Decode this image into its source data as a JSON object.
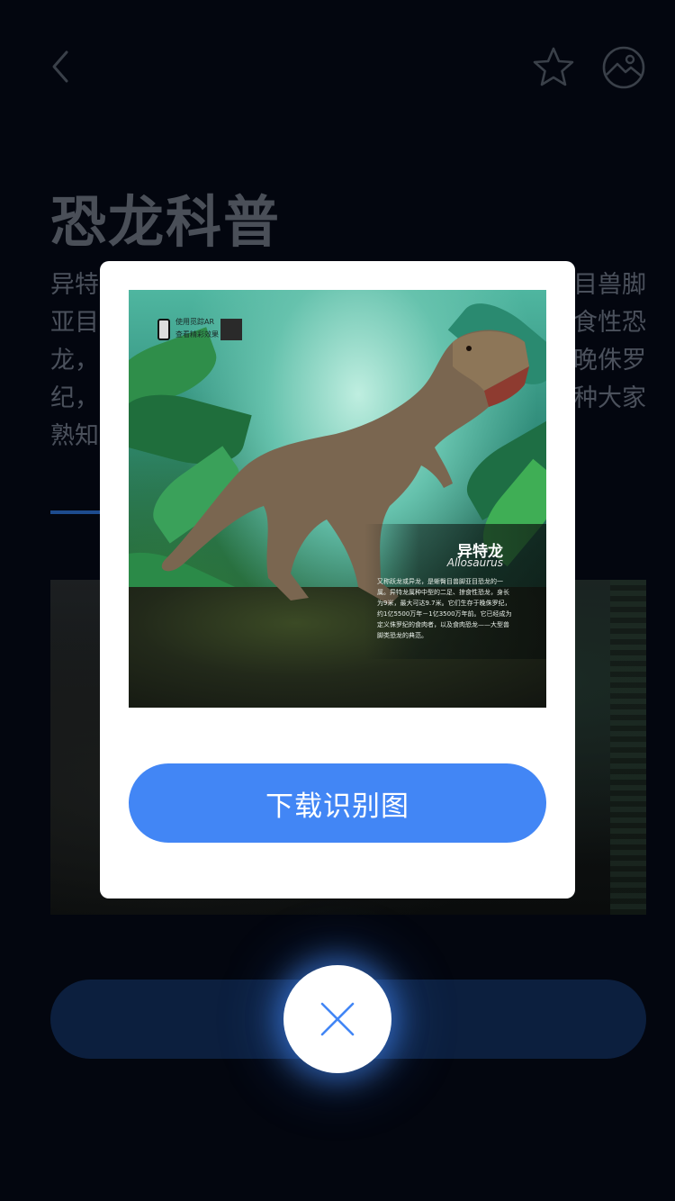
{
  "header": {
    "back_icon": "chevron-left-icon",
    "favorite_icon": "star-icon",
    "gallery_icon": "image-icon"
  },
  "page": {
    "title": "恐龙科普",
    "intro_lines": [
      {
        "left": "异特",
        "right": "目兽脚"
      },
      {
        "left": "亚目",
        "right": "食性恐"
      },
      {
        "left": "龙，",
        "right": "晚侏罗"
      },
      {
        "left": "纪，",
        "right": "种大家"
      },
      {
        "left": "熟知",
        "right": ""
      }
    ]
  },
  "modal": {
    "marker_image": {
      "ar_hint_line1": "使用觅踪AR",
      "ar_hint_line2": "查看精彩效果",
      "dino_name": "异特龙",
      "dino_latin": "Allosaurus",
      "dino_desc": "又称跃龙或异龙，是蜥臀目兽脚亚目恐龙的一属。异特龙属种中型的二足、掠食性恐龙，身长为9米，最大可达9.7米。它们生存于晚侏罗纪，约1亿5500万年－1亿3500万年前。它已经成为定义侏罗纪的食肉者，以及食肉恐龙——大型兽脚类恐龙的典范。"
    },
    "download_label": "下载识别图"
  },
  "close_icon": "close-icon",
  "colors": {
    "background": "#03060f",
    "accent": "#4286f5",
    "modal_bg": "#ffffff"
  }
}
